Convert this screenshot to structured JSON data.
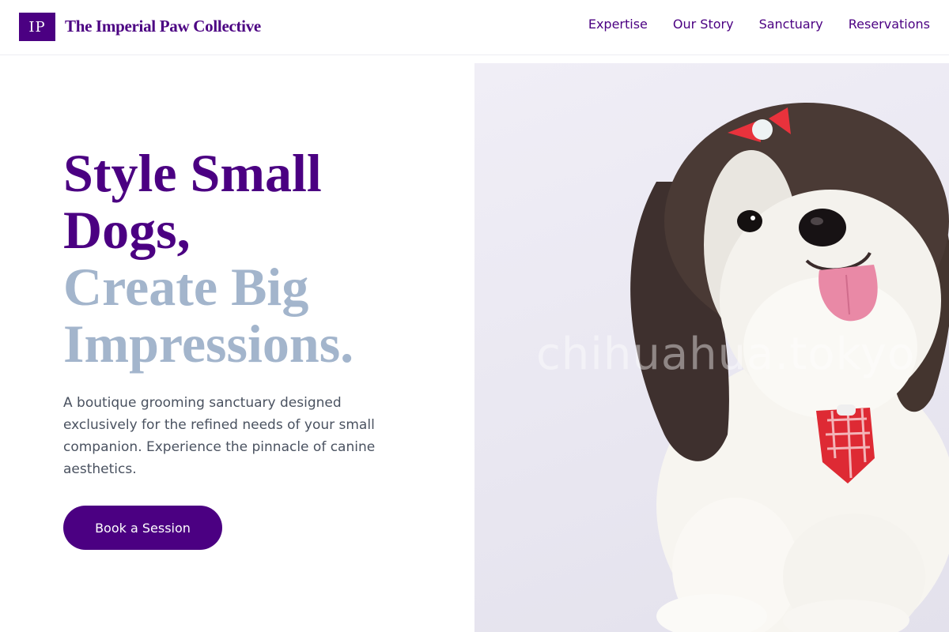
{
  "header": {
    "logo_mark": "IP",
    "brand_name": "The Imperial Paw Collective",
    "nav": [
      {
        "label": "Expertise"
      },
      {
        "label": "Our Story"
      },
      {
        "label": "Sanctuary"
      },
      {
        "label": "Reservations"
      }
    ]
  },
  "hero": {
    "headline_line1": "Style Small",
    "headline_line2": "Dogs,",
    "headline_line3": "Create Big",
    "headline_line4": "Impressions.",
    "description": "A boutique grooming sanctuary designed exclusively for the refined needs of your small companion. Experience the pinnacle of canine aesthetics.",
    "cta_label": "Book a Session",
    "image_watermark": "chihuahua.tokyo"
  },
  "colors": {
    "brand": "#4b0082",
    "headline_accent": "#a3b5cc",
    "body_text": "#4a5260",
    "image_background": "#ebe9f2"
  }
}
